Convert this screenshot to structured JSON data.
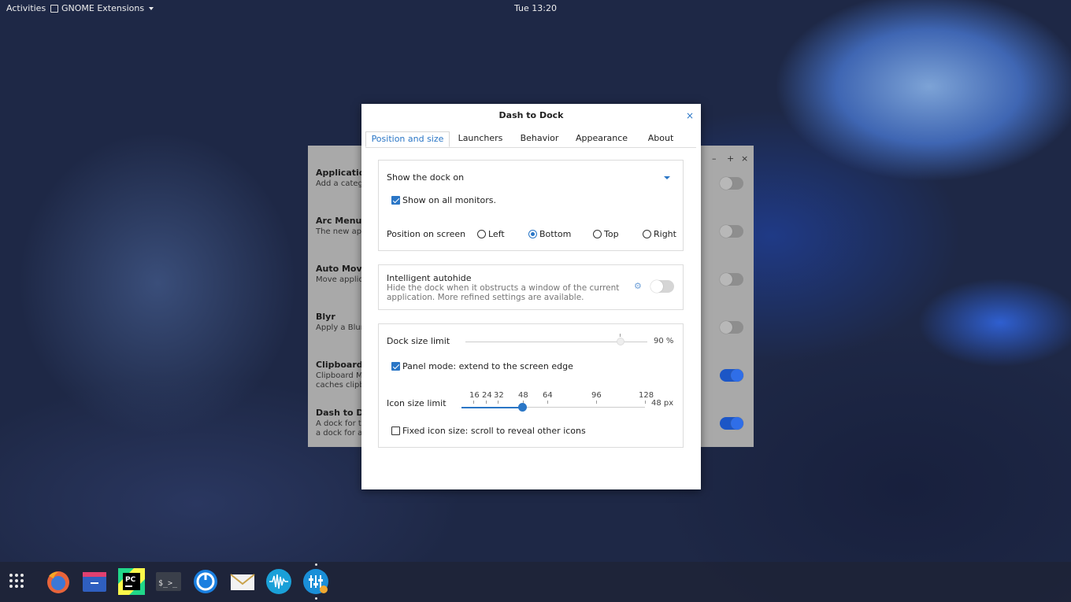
{
  "topbar": {
    "activities": "Activities",
    "app_name": "GNOME Extensions",
    "clock": "Tue 13:20"
  },
  "bg_window": {
    "controls": [
      "–",
      "+",
      "×"
    ],
    "extensions": [
      {
        "title": "Application",
        "desc": "Add a catego",
        "enabled": false
      },
      {
        "title": "Arc Menu",
        "desc": "The new appl",
        "enabled": false
      },
      {
        "title": "Auto Move",
        "desc": "Move applic",
        "enabled": false
      },
      {
        "title": "Blyr",
        "desc": "Apply a Blur",
        "enabled": false
      },
      {
        "title": "Clipboard In",
        "desc": "Clipboard M\ncaches clipb",
        "enabled": true
      },
      {
        "title": "Dash to Doc",
        "desc": "A dock for th\na dock for an",
        "enabled": true
      }
    ]
  },
  "dialog": {
    "title": "Dash to Dock",
    "close": "×",
    "tabs": [
      "Position and size",
      "Launchers",
      "Behavior",
      "Appearance",
      "About"
    ],
    "active_tab": 0,
    "show_dock_on": {
      "label": "Show the dock on",
      "all_monitors_label": "Show on all monitors.",
      "all_monitors_checked": true
    },
    "position": {
      "label": "Position on screen",
      "options": [
        "Left",
        "Bottom",
        "Top",
        "Right"
      ],
      "selected": "Bottom"
    },
    "autohide": {
      "title": "Intelligent autohide",
      "desc": "Hide the dock when it obstructs a window of the current application. More refined settings are available.",
      "enabled": false
    },
    "dock_size": {
      "label": "Dock size limit",
      "value": 0.9,
      "value_text": "90 %"
    },
    "panel_mode": {
      "label": "Panel mode: extend to the screen edge",
      "checked": true
    },
    "icon_size": {
      "label": "Icon size limit",
      "marks": [
        "16",
        "24",
        "32",
        "48",
        "64",
        "96",
        "128"
      ],
      "value": 48,
      "value_text": "48 px"
    },
    "fixed_icon": {
      "label": "Fixed icon size: scroll to reveal other icons",
      "checked": false
    }
  },
  "dock": {
    "items": [
      "show-apps",
      "firefox",
      "files",
      "pycharm",
      "terminal",
      "timeshift",
      "mail",
      "audio",
      "extensions"
    ],
    "colors": {
      "firefox": "#e8643a",
      "files": "#2f5fc0",
      "pycharm": "#21d789",
      "terminal": "#3a3f4a",
      "timeshift": "#1a7fe0",
      "mail": "#f2f2f2",
      "audio": "#1aa0d8",
      "extensions": "#1a8fd8"
    }
  }
}
